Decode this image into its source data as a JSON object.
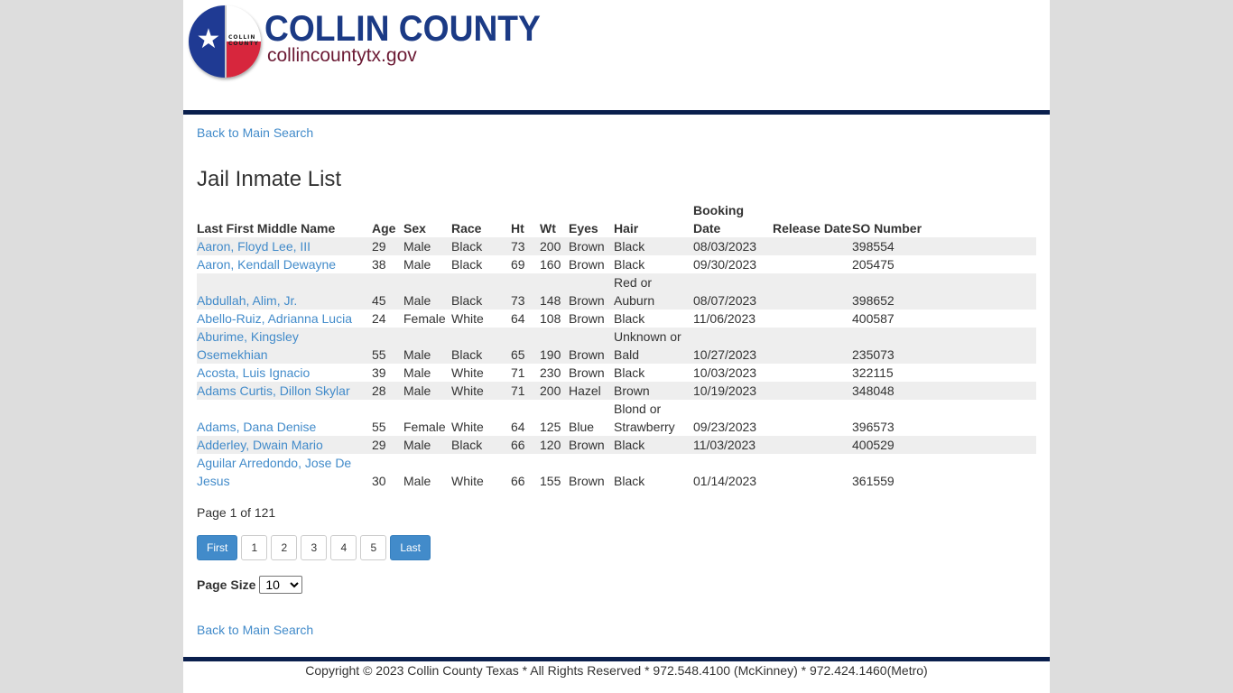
{
  "header": {
    "logo_badge": [
      "COLLIN",
      "COUNTY"
    ],
    "logo_icon": "star-icon",
    "brand_title": "COLLIN COUNTY",
    "brand_url": "collincountytx.gov"
  },
  "nav": {
    "back_top": "Back to Main Search",
    "back_bottom": "Back to Main Search"
  },
  "page_title": "Jail Inmate List",
  "table": {
    "columns": [
      {
        "label": "Last First Middle Name"
      },
      {
        "label": "Age"
      },
      {
        "label": "Sex"
      },
      {
        "label": "Race"
      },
      {
        "label": "Ht"
      },
      {
        "label": "Wt"
      },
      {
        "label": "Eyes"
      },
      {
        "label": "Hair"
      },
      {
        "label": "Booking Date"
      },
      {
        "label": "Release Date"
      },
      {
        "label": "SO Number"
      }
    ],
    "rows": [
      {
        "name": "Aaron, Floyd Lee, III",
        "age": "29",
        "sex": "Male",
        "race": "Black",
        "ht": "73",
        "wt": "200",
        "eyes": "Brown",
        "hair": "Black",
        "booking": "08/03/2023",
        "release": "",
        "so": "398554"
      },
      {
        "name": "Aaron, Kendall Dewayne",
        "age": "38",
        "sex": "Male",
        "race": "Black",
        "ht": "69",
        "wt": "160",
        "eyes": "Brown",
        "hair": "Black",
        "booking": "09/30/2023",
        "release": "",
        "so": "205475"
      },
      {
        "name": "Abdullah, Alim, Jr.",
        "age": "45",
        "sex": "Male",
        "race": "Black",
        "ht": "73",
        "wt": "148",
        "eyes": "Brown",
        "hair": "Red or Auburn",
        "booking": "08/07/2023",
        "release": "",
        "so": "398652"
      },
      {
        "name": "Abello-Ruiz, Adrianna Lucia",
        "age": "24",
        "sex": "Female",
        "race": "White",
        "ht": "64",
        "wt": "108",
        "eyes": "Brown",
        "hair": "Black",
        "booking": "11/06/2023",
        "release": "",
        "so": "400587"
      },
      {
        "name": "Aburime, Kingsley Osemekhian",
        "age": "55",
        "sex": "Male",
        "race": "Black",
        "ht": "65",
        "wt": "190",
        "eyes": "Brown",
        "hair": "Unknown or Bald",
        "booking": "10/27/2023",
        "release": "",
        "so": "235073"
      },
      {
        "name": "Acosta, Luis Ignacio",
        "age": "39",
        "sex": "Male",
        "race": "White",
        "ht": "71",
        "wt": "230",
        "eyes": "Brown",
        "hair": "Black",
        "booking": "10/03/2023",
        "release": "",
        "so": "322115"
      },
      {
        "name": "Adams Curtis, Dillon Skylar",
        "age": "28",
        "sex": "Male",
        "race": "White",
        "ht": "71",
        "wt": "200",
        "eyes": "Hazel",
        "hair": "Brown",
        "booking": "10/19/2023",
        "release": "",
        "so": "348048"
      },
      {
        "name": "Adams, Dana Denise",
        "age": "55",
        "sex": "Female",
        "race": "White",
        "ht": "64",
        "wt": "125",
        "eyes": "Blue",
        "hair": "Blond or Strawberry",
        "booking": "09/23/2023",
        "release": "",
        "so": "396573"
      },
      {
        "name": "Adderley, Dwain Mario",
        "age": "29",
        "sex": "Male",
        "race": "Black",
        "ht": "66",
        "wt": "120",
        "eyes": "Brown",
        "hair": "Black",
        "booking": "11/03/2023",
        "release": "",
        "so": "400529"
      },
      {
        "name": "Aguilar Arredondo, Jose De Jesus",
        "age": "30",
        "sex": "Male",
        "race": "White",
        "ht": "66",
        "wt": "155",
        "eyes": "Brown",
        "hair": "Black",
        "booking": "01/14/2023",
        "release": "",
        "so": "361559"
      }
    ]
  },
  "pagination": {
    "info": "Page 1 of 121",
    "first_label": "First",
    "last_label": "Last",
    "pages": [
      "1",
      "2",
      "3",
      "4",
      "5"
    ]
  },
  "page_size": {
    "label": "Page Size",
    "selected": "10"
  },
  "footer": {
    "text": "Copyright © 2023 Collin County Texas * All Rights Reserved * 972.548.4100 (McKinney) * 972.424.1460(Metro)"
  },
  "colors": {
    "brand_blue": "#1b3a85",
    "brand_maroon": "#6b1a34",
    "bar_navy": "#0a1f4d",
    "link": "#428bca",
    "button_primary": "#428bca",
    "row_stripe": "#eeeeee"
  }
}
